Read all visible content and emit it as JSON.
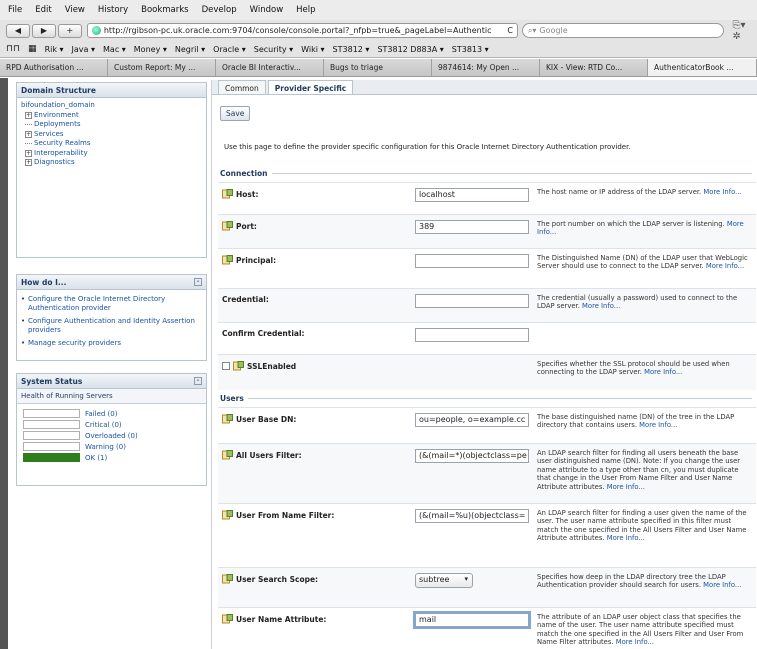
{
  "menubar": {
    "items": [
      "File",
      "Edit",
      "View",
      "History",
      "Bookmarks",
      "Develop",
      "Window",
      "Help"
    ]
  },
  "navbar": {
    "back": "◀",
    "forward": "▶",
    "add": "+",
    "url": "http://rgibson-pc.uk.oracle.com:9704/console/console.portal?_nfpb=true&_pageLabel=Authentic",
    "reload": "C",
    "search_placeholder": "Google",
    "icons": "⎘▾  ✲"
  },
  "bookmarks": {
    "items": [
      "Rik ▾",
      "Java ▾",
      "Mac ▾",
      "Money ▾",
      "Negril ▾",
      "Oracle ▾",
      "Security ▾",
      "Wiki ▾",
      "ST3812 ▾",
      "ST3812 D883A ▾",
      "ST3813 ▾"
    ]
  },
  "tabs": [
    "RPD Authorisation ...",
    "Custom Report: My ...",
    "Oracle BI Interactiv...",
    "Bugs to triage",
    "9874614: My Open ...",
    "KIX - View: RTD Co...",
    "AuthenticatorBook ..."
  ],
  "domain": {
    "title": "Domain Structure",
    "root": "bifoundation_domain",
    "nodes": [
      "Environment",
      "Deployments",
      "Services",
      "Security Realms",
      "Interoperability",
      "Diagnostics"
    ]
  },
  "howdo": {
    "title": "How do I...",
    "items": [
      "Configure the Oracle Internet Directory Authentication provider",
      "Configure Authentication and Identity Assertion providers",
      "Manage security providers"
    ]
  },
  "status": {
    "title": "System Status",
    "subtitle": "Health of Running Servers",
    "legend": [
      "Failed (0)",
      "Critical (0)",
      "Overloaded (0)",
      "Warning (0)",
      "OK (1)"
    ]
  },
  "content": {
    "tabs": [
      "Common",
      "Provider Specific"
    ],
    "save_label": "Save",
    "description": "Use this page to define the provider specific configuration for this Oracle Internet Directory Authentication provider.",
    "sections": {
      "connection": "Connection",
      "users": "Users"
    },
    "more": "More Info...",
    "fields": {
      "host": {
        "label": "Host:",
        "value": "localhost",
        "help": "The host name or IP address of the LDAP server."
      },
      "port": {
        "label": "Port:",
        "value": "389",
        "help": "The port number on which the LDAP server is listening."
      },
      "principal": {
        "label": "Principal:",
        "value": "",
        "help": "The Distinguished Name (DN) of the LDAP user that WebLogic Server should use to connect to the LDAP server."
      },
      "credential": {
        "label": "Credential:",
        "value": "",
        "help": "The credential (usually a password) used to connect to the LDAP server."
      },
      "confirm": {
        "label": "Confirm Credential:",
        "value": ""
      },
      "ssl": {
        "label": "SSLEnabled",
        "help": "Specifies whether the SSL protocol should be used when connecting to the LDAP server."
      },
      "user_base_dn": {
        "label": "User Base DN:",
        "value": "ou=people, o=example.cc",
        "help": "The base distinguished name (DN) of the tree in the LDAP directory that contains users."
      },
      "all_users_filter": {
        "label": "All Users Filter:",
        "value": "(&(mail=*)(objectclass=pe",
        "help": "An LDAP search filter for finding all users beneath the base user distinguished name (DN). Note: If you change the user name attribute to a type other than cn, you must duplicate that change in the User From Name Filter and User Name Attribute attributes."
      },
      "user_from_name_filter": {
        "label": "User From Name Filter:",
        "value": "(&(mail=%u)(objectclass=",
        "help": "An LDAP search filter for finding a user given the name of the user. The user name attribute specified in this filter must match the one specified in the All Users Filter and User Name Attribute attributes."
      },
      "user_search_scope": {
        "label": "User Search Scope:",
        "value": "subtree",
        "help": "Specifies how deep in the LDAP directory tree the LDAP Authentication provider should search for users."
      },
      "user_name_attribute": {
        "label": "User Name Attribute:",
        "value": "mail",
        "help": "The attribute of an LDAP user object class that specifies the name of the user. The user name attribute specified must match the one specified in the All Users Filter and User From Name Filter attributes."
      }
    }
  }
}
